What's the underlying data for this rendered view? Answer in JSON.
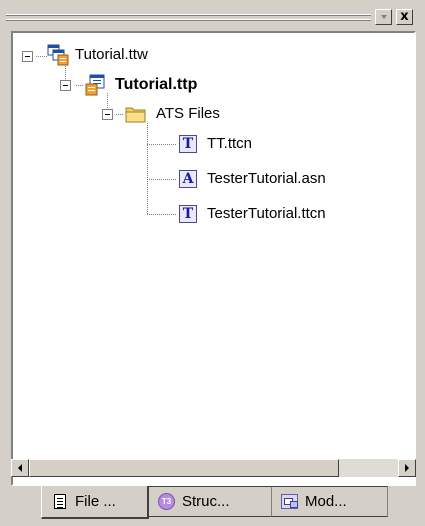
{
  "titlebar": {
    "dropdown_icon": "dropdown-arrow-icon",
    "close_label": "x",
    "close_icon": "close-icon"
  },
  "tree": {
    "workspace": {
      "label": "Tutorial.ttw",
      "icon": "workspace-icon"
    },
    "project": {
      "label": "Tutorial.ttp",
      "icon": "project-icon"
    },
    "folder": {
      "label": "ATS Files",
      "icon": "folder-icon"
    },
    "files": [
      {
        "label": "TT.ttcn",
        "badge": "T",
        "icon": "ttcn-file-icon"
      },
      {
        "label": "TesterTutorial.asn",
        "badge": "A",
        "icon": "asn-file-icon"
      },
      {
        "label": "TesterTutorial.ttcn",
        "badge": "T",
        "icon": "ttcn-file-icon"
      }
    ]
  },
  "scrollbar": {
    "left_icon": "scroll-left-arrow-icon",
    "right_icon": "scroll-right-arrow-icon"
  },
  "tabs": [
    {
      "label": "File ...",
      "icon": "document-icon",
      "active": true
    },
    {
      "label": "Struc...",
      "badge": "T3",
      "icon": "t3-structure-icon",
      "active": false
    },
    {
      "label": "Mod...",
      "icon": "module-icon",
      "active": false
    }
  ],
  "colors": {
    "chrome": "#d4d0c8",
    "panel_bg": "#ffffff",
    "file_badge": "#1a1aa8",
    "folder": "#f0d060",
    "t3_badge": "#b88be0"
  }
}
